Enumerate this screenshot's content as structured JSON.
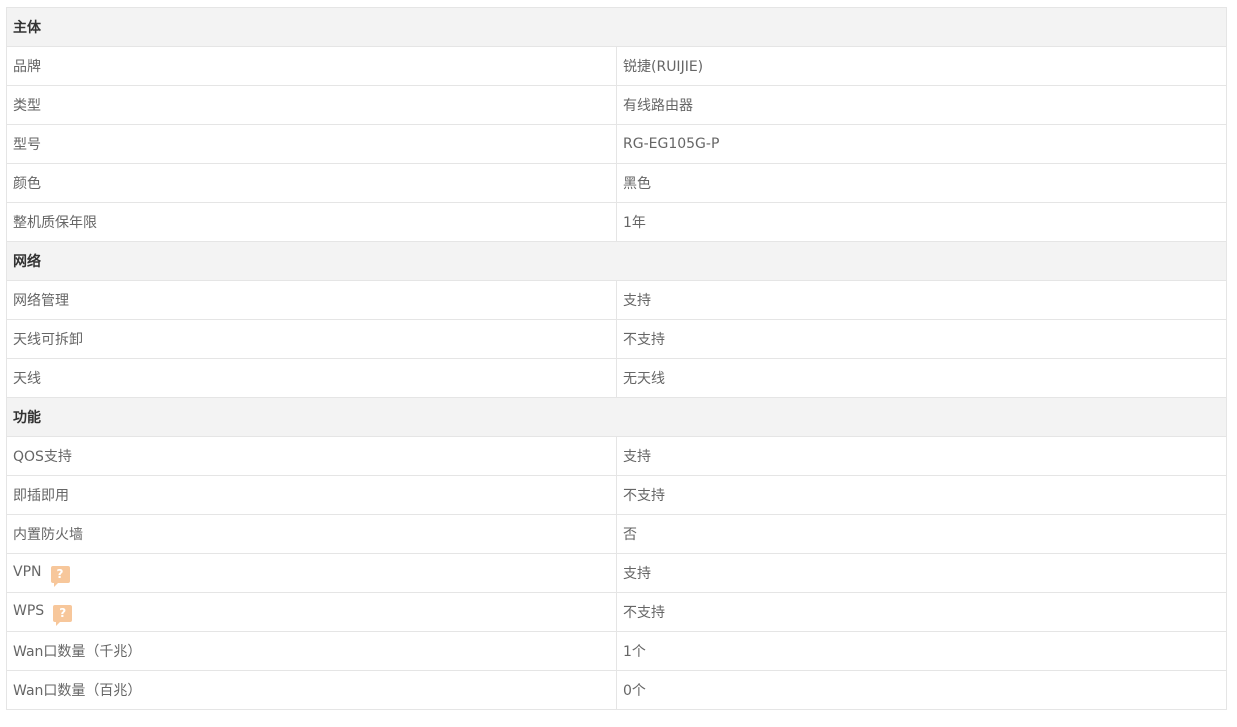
{
  "colors": {
    "section_bg": "#f3f3f3",
    "border": "#e5e5e5",
    "text": "#666666",
    "section_text": "#333333",
    "help_icon_bg": "#f7c79b"
  },
  "sections": [
    {
      "title": "主体",
      "rows": [
        {
          "key": "品牌",
          "value": "锐捷(RUIJIE)"
        },
        {
          "key": "类型",
          "value": "有线路由器"
        },
        {
          "key": "型号",
          "value": "RG-EG105G-P"
        },
        {
          "key": "颜色",
          "value": "黑色"
        },
        {
          "key": "整机质保年限",
          "value": "1年"
        }
      ]
    },
    {
      "title": "网络",
      "rows": [
        {
          "key": "网络管理",
          "value": "支持"
        },
        {
          "key": "天线可拆卸",
          "value": "不支持"
        },
        {
          "key": "天线",
          "value": "无天线"
        }
      ]
    },
    {
      "title": "功能",
      "rows": [
        {
          "key": "QOS支持",
          "value": "支持"
        },
        {
          "key": "即插即用",
          "value": "不支持"
        },
        {
          "key": "内置防火墙",
          "value": "否"
        },
        {
          "key": "VPN",
          "value": "支持",
          "help": true
        },
        {
          "key": "WPS",
          "value": "不支持",
          "help": true
        },
        {
          "key": "Wan口数量（千兆）",
          "value": "1个"
        },
        {
          "key": "Wan口数量（百兆）",
          "value": "0个"
        }
      ]
    }
  ],
  "help_icon": {
    "glyph": "?",
    "icon": "help-question-icon"
  }
}
